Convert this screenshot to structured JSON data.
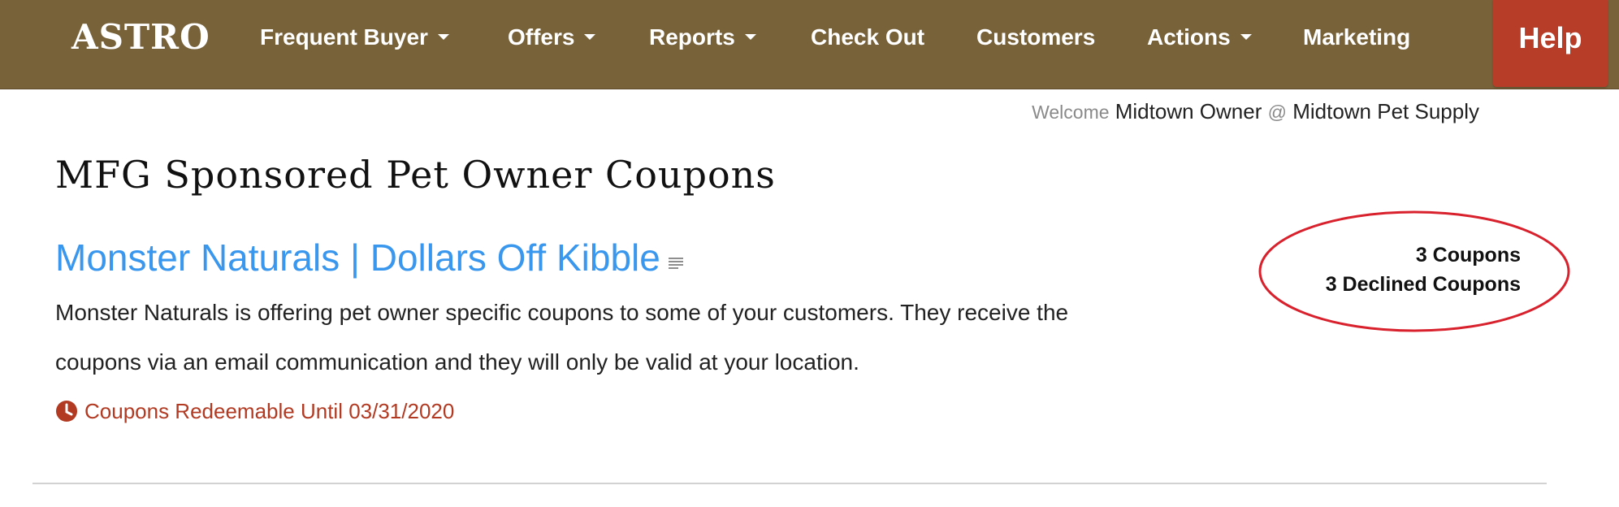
{
  "nav": {
    "logo": "ASTRO",
    "items": [
      {
        "label": "Frequent Buyer",
        "dropdown": true
      },
      {
        "label": "Offers",
        "dropdown": true
      },
      {
        "label": "Reports",
        "dropdown": true
      },
      {
        "label": "Check Out",
        "dropdown": false
      },
      {
        "label": "Customers",
        "dropdown": false
      },
      {
        "label": "Actions",
        "dropdown": true
      },
      {
        "label": "Marketing",
        "dropdown": false
      }
    ],
    "help_label": "Help"
  },
  "welcome": {
    "prefix": "Welcome",
    "user": "Midtown Owner",
    "at": "@",
    "store": "Midtown Pet Supply"
  },
  "page": {
    "title": "MFG Sponsored Pet Owner Coupons"
  },
  "offer": {
    "title": "Monster Naturals | Dollars Off Kibble",
    "description": "Monster Naturals is offering pet owner specific coupons to some of your customers. They receive the coupons via an email communication and they will only be valid at your location.",
    "redeemable": "Coupons Redeemable Until 03/31/2020",
    "coupons": "3 Coupons",
    "declined": "3 Declined Coupons"
  },
  "colors": {
    "navbar": "#78623a",
    "help": "#b83d28",
    "link": "#3a97ee",
    "alert": "#b23a22",
    "highlight_ring": "#d8212c"
  },
  "icons": {
    "dropdown": "chevron-down-icon",
    "offer_details": "document-lines-icon",
    "expiry": "clock-icon"
  }
}
